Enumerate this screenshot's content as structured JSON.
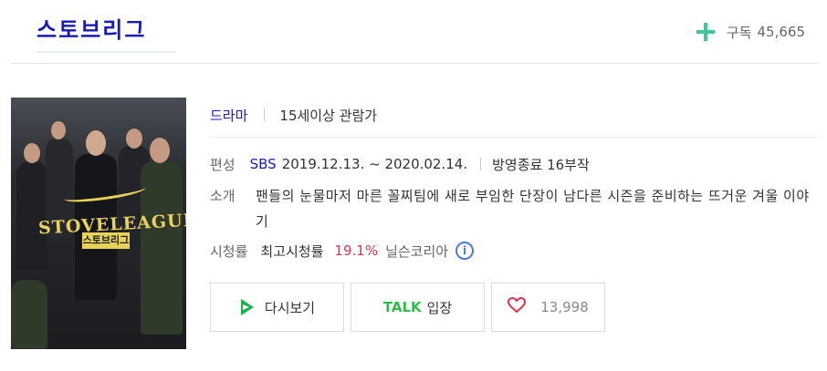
{
  "header": {
    "title": "스토브리그",
    "subscribe_label": "구독",
    "subscribe_count": "45,665"
  },
  "poster": {
    "logo_text": "STOVELEAGUE",
    "logo_kr": "스토브리그"
  },
  "info": {
    "genre": "드라마",
    "age_rating": "15세이상 관람가",
    "schedule_label": "편성",
    "network": "SBS",
    "dates": "2019.12.13. ~ 2020.02.14.",
    "status": "방영종료 16부작",
    "synopsis_label": "소개",
    "synopsis": "팬들의 눈물마저 마른 꼴찌팀에 새로 부임한 단장이 남다른 시즌을 준비하는 뜨거운 겨울 이야기",
    "ratings_label": "시청률",
    "ratings_sublabel": "최고시청률",
    "ratings_value": "19.1%",
    "ratings_source": "닐슨코리아"
  },
  "actions": {
    "replay_label": "다시보기",
    "talk_brand": "TALK",
    "talk_label": "입장",
    "like_count": "13,998"
  },
  "colors": {
    "title": "#1a1ab8",
    "accent_green": "#3fc79a",
    "rating_red": "#e0304b",
    "talk_green": "#2bbf4a"
  }
}
